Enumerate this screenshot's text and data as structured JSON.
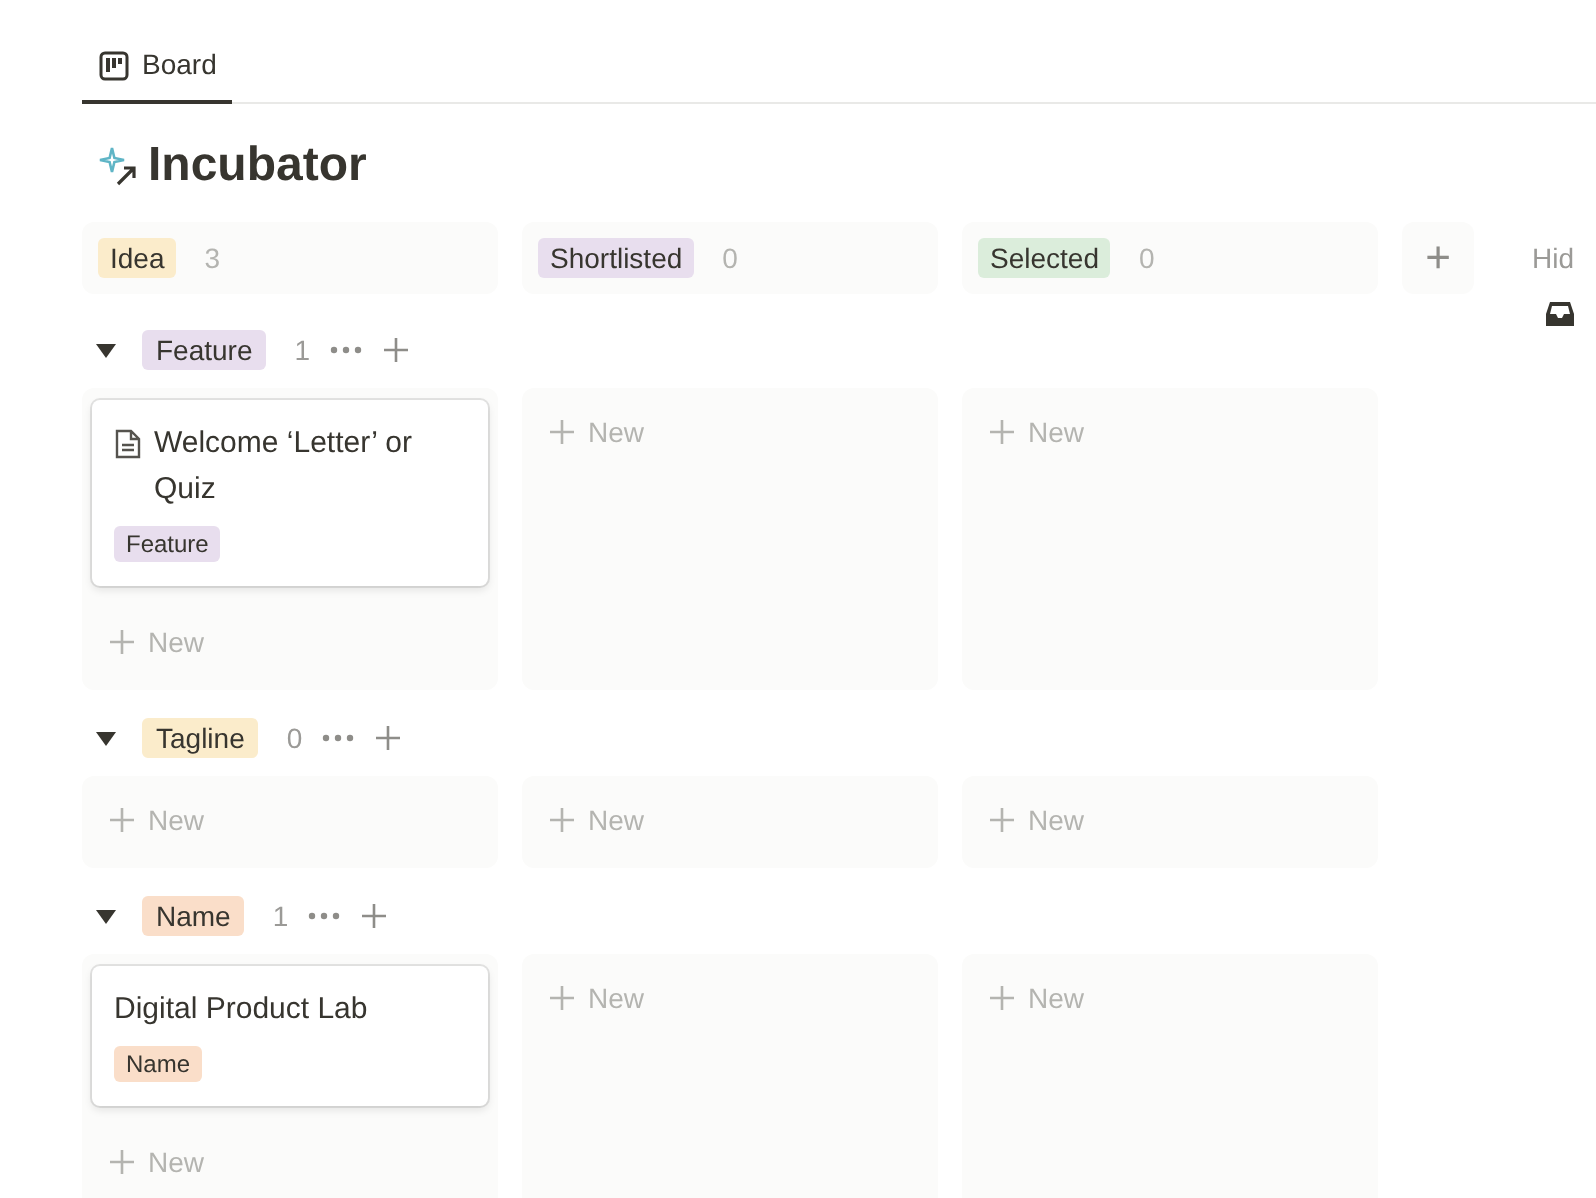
{
  "tabs": [
    {
      "label": "Board",
      "selected": true
    }
  ],
  "title": "Incubator",
  "columns": [
    {
      "label": "Idea",
      "count": "3",
      "color": "#fbeccb"
    },
    {
      "label": "Shortlisted",
      "count": "0",
      "color": "#e8deee"
    },
    {
      "label": "Selected",
      "count": "0",
      "color": "#dbeddb"
    }
  ],
  "add_column": "+",
  "hidden_label": "Hid",
  "groups": [
    {
      "label": "Feature",
      "count": "1",
      "color": "#e8deee",
      "expanded": true,
      "cells": [
        {
          "cards": [
            {
              "title": "Welcome ‘Letter’ or Quiz",
              "kind": "page",
              "tag": "Feature",
              "color": "#e8deee"
            }
          ],
          "new_label": "New"
        },
        {
          "new_label": "New"
        },
        {
          "new_label": "New"
        }
      ]
    },
    {
      "label": "Tagline",
      "count": "0",
      "color": "#fbeccb",
      "expanded": true,
      "cells": [
        {
          "new_label": "New"
        },
        {
          "new_label": "New"
        },
        {
          "new_label": "New"
        }
      ]
    },
    {
      "label": "Name",
      "count": "1",
      "color": "#fadec9",
      "expanded": true,
      "cells": [
        {
          "cards": [
            {
              "title": "Digital Product Lab",
              "kind": "plain",
              "tag": "Name",
              "color": "#fadec9"
            }
          ],
          "new_label": "New"
        },
        {
          "new_label": "New"
        },
        {
          "new_label": "New"
        }
      ]
    }
  ]
}
